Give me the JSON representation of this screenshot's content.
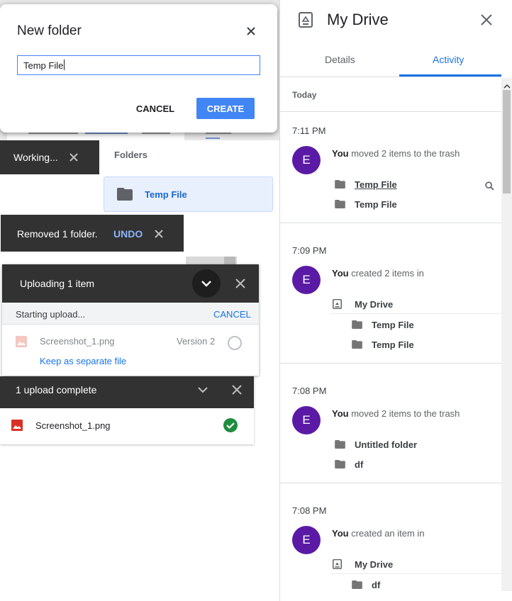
{
  "dialog": {
    "title": "New folder",
    "input_value": "Temp File",
    "cancel_label": "CANCEL",
    "create_label": "CREATE"
  },
  "snackbars": {
    "working": "Working...",
    "removed": "Removed 1 folder.",
    "undo": "UNDO"
  },
  "folders": {
    "label": "Folders",
    "items": [
      {
        "name": "Temp File"
      }
    ]
  },
  "upload_panel": {
    "title": "Uploading 1 item",
    "status": "Starting upload...",
    "cancel_label": "CANCEL",
    "file_name": "Screenshot_1.png",
    "version": "Version 2",
    "keep_separate": "Keep as separate file"
  },
  "complete_panel": {
    "title": "1 upload complete",
    "file_name": "Screenshot_1.png"
  },
  "details_panel": {
    "title": "My Drive",
    "tabs": [
      "Details",
      "Activity"
    ],
    "active_tab": "Activity",
    "section": "Today",
    "actor": "You",
    "avatar_letter": "E",
    "avatar_color": "#5b1aa5",
    "accent_color": "#1a73e8",
    "activities": [
      {
        "time": "7:11 PM",
        "action": "moved 2 items to the trash",
        "items": [
          "Temp File",
          "Temp File"
        ]
      },
      {
        "time": "7:09 PM",
        "action": "created 2 items in",
        "location": "My Drive",
        "items": [
          "Temp File",
          "Temp File"
        ]
      },
      {
        "time": "7:08 PM",
        "action": "moved 2 items to the trash",
        "items": [
          "Untitled folder",
          "df"
        ]
      },
      {
        "time": "7:08 PM",
        "action": "created an item in",
        "location": "My Drive",
        "items": [
          "df"
        ]
      }
    ]
  }
}
